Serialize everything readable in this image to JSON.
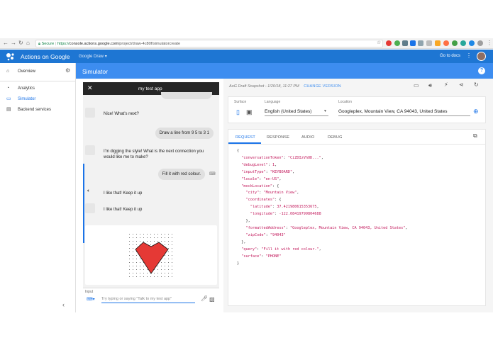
{
  "browser": {
    "secure_label": "Secure",
    "url_scheme": "https://",
    "url_host": "console.actions.google.com",
    "url_path": "/project/draw-4c80f/simulatorcreate"
  },
  "appbar": {
    "title": "Actions on Google",
    "project": "Google Draw",
    "docs_label": "Go to docs"
  },
  "sidebar": {
    "items": [
      {
        "label": "Overview",
        "icon": "home-icon"
      },
      {
        "label": "Analytics",
        "icon": "analytics-icon"
      },
      {
        "label": "Simulator",
        "icon": "simulator-icon"
      },
      {
        "label": "Backend services",
        "icon": "backend-icon"
      }
    ],
    "collapse_glyph": "‹"
  },
  "simulator": {
    "title": "Simulator"
  },
  "phone": {
    "app_name": "my test app",
    "messages": [
      {
        "from": "app",
        "text": "Nice! What's next?"
      },
      {
        "from": "user",
        "text": "Draw a line from 9 5 to 3 1"
      },
      {
        "from": "app",
        "text": "I'm digging the style! What is the next connection you would like me to make?"
      },
      {
        "from": "user",
        "text": "Fill it with red colour."
      },
      {
        "from": "app",
        "text": "I like that! Keep it up"
      },
      {
        "from": "app",
        "text": "I like that! Keep it up"
      }
    ],
    "input_label": "Input",
    "input_placeholder": "Try typing or saying \"Talk to my test app\""
  },
  "right": {
    "snapshot": "AoG Draft Snapshot - 1/20/18, 11:27 PM",
    "change_version": "CHANGE VERSION",
    "surface_label": "Surface",
    "language_label": "Language",
    "language_value": "English (United States)",
    "location_label": "Location",
    "location_value": "Googleplex, Mountain View, CA 94043, United States",
    "tabs": [
      "REQUEST",
      "RESPONSE",
      "AUDIO",
      "DEBUG"
    ],
    "active_tab": "REQUEST",
    "code_lines": [
      "{",
      "  \"conversationToken\": \"CiZDIzVhOD...\",",
      "  \"debugLevel\": 1,",
      "  \"inputType\": \"KEYBOARD\",",
      "  \"locale\": \"en-US\",",
      "  \"mockLocation\": {",
      "    \"city\": \"Mountain View\",",
      "    \"coordinates\": {",
      "      \"latitude\": 37.421980615353675,",
      "      \"longitude\": -122.08419799804688",
      "    },",
      "    \"formattedAddress\": \"Googleplex, Mountain View, CA 94043, United States\",",
      "    \"zipCode\": \"94043\"",
      "  },",
      "  \"query\": \"Fill it with red colour.\",",
      "  \"surface\": \"PHONE\"",
      "}"
    ]
  },
  "colors": {
    "appbar": "#1e76d3",
    "simulator_header": "#3d8df0",
    "heart": "#e53935",
    "phone_bar": "#262626"
  }
}
